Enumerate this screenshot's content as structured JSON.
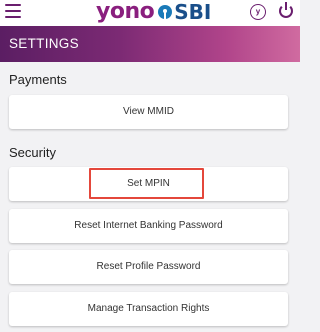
{
  "header": {
    "logo_text_left": "yono",
    "logo_text_right": "SBI",
    "yono_badge": "y",
    "settings_title": "SETTINGS"
  },
  "sections": [
    {
      "title": "Payments",
      "items": [
        {
          "label": "View MMID"
        }
      ]
    },
    {
      "title": "Security",
      "items": [
        {
          "label": "Set MPIN",
          "highlighted": true
        },
        {
          "label": "Reset Internet Banking Password"
        },
        {
          "label": "Reset Profile Password"
        },
        {
          "label": "Manage Transaction Rights"
        }
      ]
    }
  ],
  "colors": {
    "brand_purple": "#6a1e6e",
    "highlight_red": "#e4473b"
  },
  "icons": [
    "menu-icon",
    "yono-profile-icon",
    "power-icon",
    "sbi-logo-icon"
  ]
}
